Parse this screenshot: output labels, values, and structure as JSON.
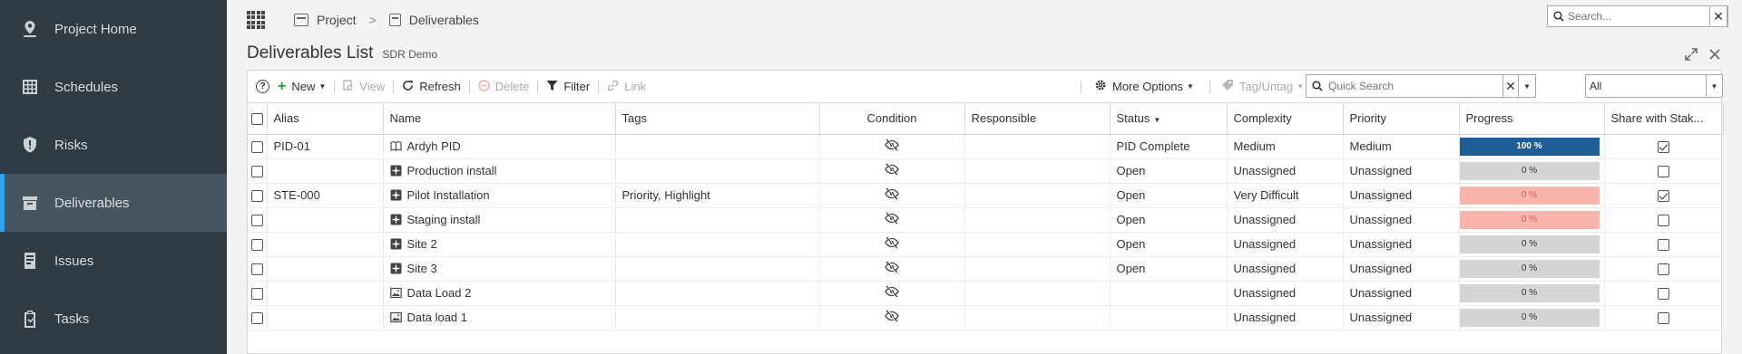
{
  "sidebar": {
    "items": [
      {
        "label": "Project Home",
        "icon": "map-pin-icon"
      },
      {
        "label": "Schedules",
        "icon": "grid-calendar-icon"
      },
      {
        "label": "Risks",
        "icon": "shield-icon"
      },
      {
        "label": "Deliverables",
        "icon": "box-icon",
        "active": true
      },
      {
        "label": "Issues",
        "icon": "document-icon"
      },
      {
        "label": "Tasks",
        "icon": "clipboard-check-icon"
      }
    ]
  },
  "breadcrumb": {
    "project": "Project",
    "deliverables": "Deliverables",
    "separator": ">"
  },
  "global_search": {
    "placeholder": "Search...",
    "clear": "✕"
  },
  "page": {
    "title": "Deliverables List",
    "subtitle": "SDR Demo"
  },
  "toolbar": {
    "help": "?",
    "new": "New",
    "view": "View",
    "refresh": "Refresh",
    "delete": "Delete",
    "filter": "Filter",
    "link": "Link",
    "more_options": "More Options",
    "tag_untag": "Tag/Untag",
    "quick_search_placeholder": "Quick Search",
    "scope_value": "All"
  },
  "table": {
    "headers": {
      "alias": "Alias",
      "name": "Name",
      "tags": "Tags",
      "condition": "Condition",
      "responsible": "Responsible",
      "status": "Status",
      "complexity": "Complexity",
      "priority": "Priority",
      "progress": "Progress",
      "share": "Share with Stak..."
    },
    "rows": [
      {
        "alias": "PID-01",
        "name": "Ardyh PID",
        "icon": "book-icon",
        "tags": "",
        "responsible": "",
        "status": "PID Complete",
        "complexity": "Medium",
        "priority": "Medium",
        "progress": "100 %",
        "progress_value": 100,
        "progress_state": "done",
        "share": true
      },
      {
        "alias": "",
        "name": "Production install",
        "icon": "puzzle-icon",
        "tags": "",
        "responsible": "",
        "status": "Open",
        "complexity": "Unassigned",
        "priority": "Unassigned",
        "progress": "0 %",
        "progress_value": 0,
        "progress_state": "none",
        "share": false
      },
      {
        "alias": "STE-000",
        "name": "Pilot Installation",
        "icon": "puzzle-icon",
        "tags": "Priority, Highlight",
        "responsible": "",
        "status": "Open",
        "complexity": "Very Difficult",
        "priority": "Unassigned",
        "progress": "0 %",
        "progress_value": 0,
        "progress_state": "late",
        "share": true
      },
      {
        "alias": "",
        "name": "Staging install",
        "icon": "puzzle-icon",
        "tags": "",
        "responsible": "",
        "status": "Open",
        "complexity": "Unassigned",
        "priority": "Unassigned",
        "progress": "0 %",
        "progress_value": 0,
        "progress_state": "late",
        "share": false
      },
      {
        "alias": "",
        "name": "Site 2",
        "icon": "puzzle-icon",
        "tags": "",
        "responsible": "",
        "status": "Open",
        "complexity": "Unassigned",
        "priority": "Unassigned",
        "progress": "0 %",
        "progress_value": 0,
        "progress_state": "none",
        "share": false
      },
      {
        "alias": "",
        "name": "Site 3",
        "icon": "puzzle-icon",
        "tags": "",
        "responsible": "",
        "status": "Open",
        "complexity": "Unassigned",
        "priority": "Unassigned",
        "progress": "0 %",
        "progress_value": 0,
        "progress_state": "none",
        "share": false
      },
      {
        "alias": "",
        "name": "Data Load 2",
        "icon": "image-icon",
        "tags": "",
        "responsible": "",
        "status": "",
        "complexity": "Unassigned",
        "priority": "Unassigned",
        "progress": "0 %",
        "progress_value": 0,
        "progress_state": "none",
        "share": false
      },
      {
        "alias": "",
        "name": "Data load 1",
        "icon": "image-icon",
        "tags": "",
        "responsible": "",
        "status": "",
        "complexity": "Unassigned",
        "priority": "Unassigned",
        "progress": "0 %",
        "progress_value": 0,
        "progress_state": "none",
        "share": false
      }
    ]
  },
  "colors": {
    "sidebar_bg": "#2e3a44",
    "sidebar_active_bg": "#475560",
    "sidebar_accent": "#2ea3f2",
    "progress_done": "#1f5d96",
    "progress_none": "#d5d5d5",
    "progress_late": "#f9b5ad"
  }
}
